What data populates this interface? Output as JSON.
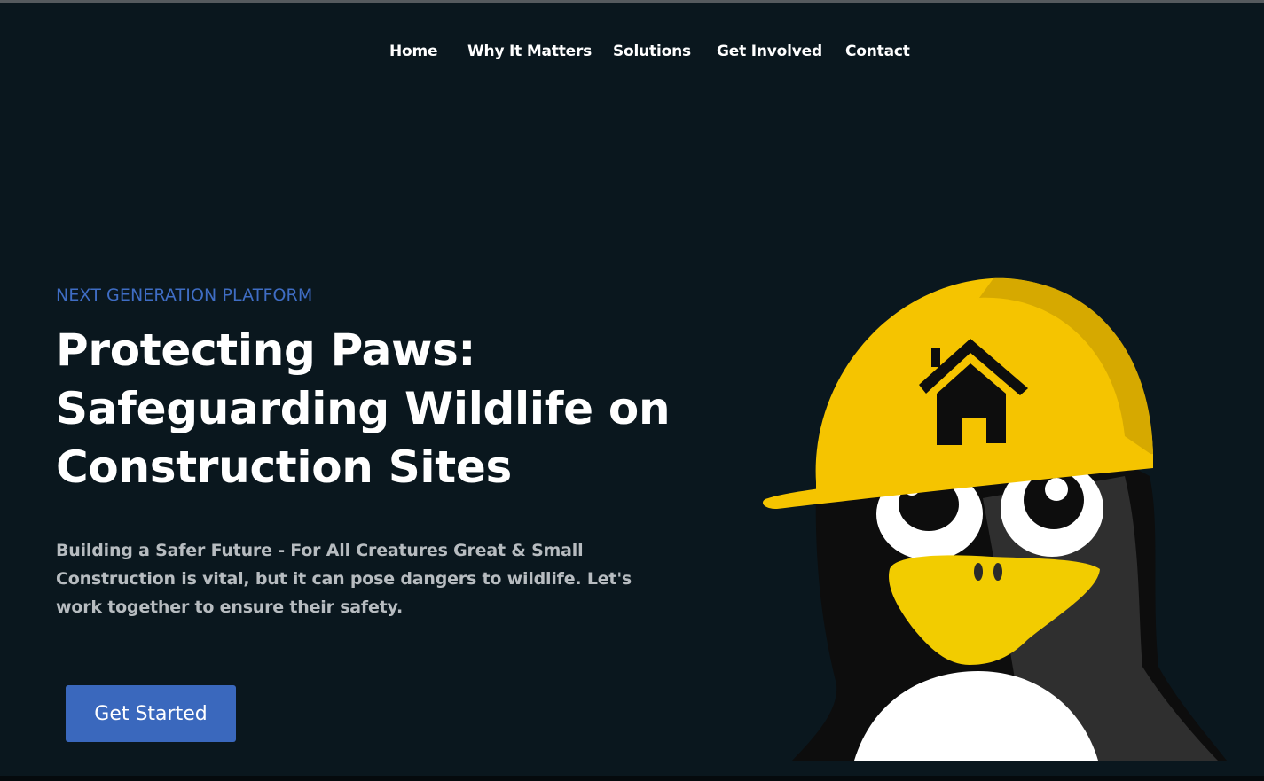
{
  "nav": {
    "items": [
      {
        "label": "Home"
      },
      {
        "label": "Why It Matters"
      },
      {
        "label": "Solutions"
      },
      {
        "label": "Get Involved"
      },
      {
        "label": "Contact"
      }
    ]
  },
  "hero": {
    "eyebrow": "NEXT GENERATION PLATFORM",
    "title_lines": [
      "Protecting Paws:",
      "Safeguarding Wildlife on",
      "Construction Sites"
    ],
    "body_lines": [
      "Building a Safer Future - For All Creatures Great & Small",
      "Construction is vital, but it can pose dangers to wildlife. Let's",
      "work together to ensure their safety."
    ],
    "cta_label": "Get Started"
  },
  "illustration": {
    "icon": "penguin-with-hard-hat-icon",
    "colors": {
      "helmet": "#f5c400",
      "helmet_shade": "#d6a900",
      "beak": "#f2cc00",
      "body": "#0d0d0d",
      "body_shade": "#2f2f2f"
    }
  },
  "colors": {
    "background": "#0a171e",
    "accent": "#3f6dc4",
    "button": "#3a68bd",
    "body_text": "#b7bcc0"
  }
}
